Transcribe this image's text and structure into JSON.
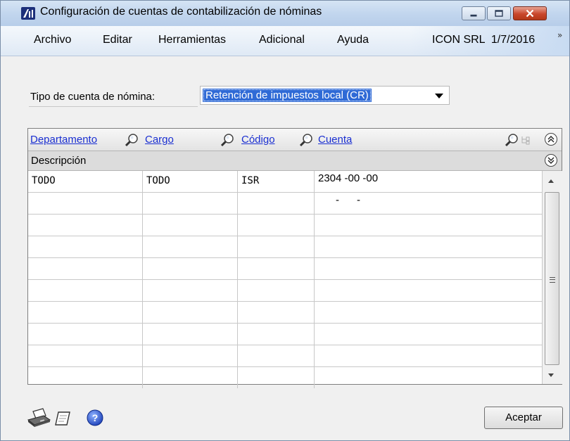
{
  "window": {
    "title": "Configuración de cuentas de contabilización de nóminas"
  },
  "menu": {
    "items": [
      "Archivo",
      "Editar",
      "Herramientas",
      "Adicional",
      "Ayuda"
    ],
    "company_date": "ICON SRL  1/7/2016",
    "overflow": "»"
  },
  "form": {
    "type_label": "Tipo de cuenta de nómina:",
    "type_value": "Retención de impuestos local (CR)"
  },
  "grid": {
    "headers": {
      "department": "Departamento",
      "position": "Cargo",
      "code": "Código",
      "account": "Cuenta"
    },
    "description_label": "Descripción",
    "rows": [
      {
        "department": "TODO",
        "position": "TODO",
        "code": "ISR",
        "account": "2304 -00 -00"
      },
      {
        "department": "",
        "position": "",
        "code": "",
        "account": "      -      -"
      },
      {
        "department": "",
        "position": "",
        "code": "",
        "account": ""
      },
      {
        "department": "",
        "position": "",
        "code": "",
        "account": ""
      },
      {
        "department": "",
        "position": "",
        "code": "",
        "account": ""
      },
      {
        "department": "",
        "position": "",
        "code": "",
        "account": ""
      },
      {
        "department": "",
        "position": "",
        "code": "",
        "account": ""
      },
      {
        "department": "",
        "position": "",
        "code": "",
        "account": ""
      },
      {
        "department": "",
        "position": "",
        "code": "",
        "account": ""
      },
      {
        "department": "",
        "position": "",
        "code": "",
        "account": ""
      }
    ]
  },
  "footer": {
    "ok_label": "Aceptar",
    "icons": [
      "printer-icon",
      "note-icon",
      "help-icon"
    ]
  },
  "colors": {
    "link": "#1a2fd1",
    "selection": "#2f6ad6",
    "close_button": "#c9462c"
  }
}
